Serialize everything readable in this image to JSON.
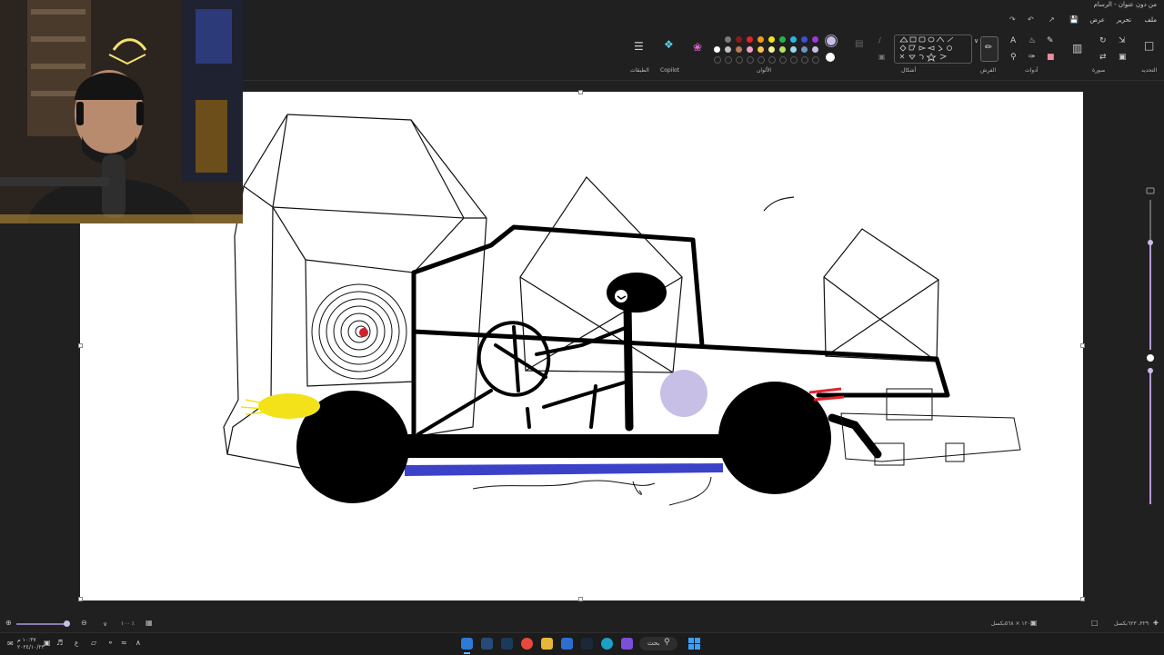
{
  "window": {
    "title": "من دون عنوان - الرسام"
  },
  "menu": {
    "file": "ملف",
    "edit": "تحرير",
    "view": "عرض"
  },
  "ribbon": {
    "groups": {
      "selection": "التحديد",
      "image": "صورة",
      "tools": "أدوات",
      "brushes": "الفرش",
      "shapes": "أشكال",
      "colors": "الألوان",
      "copilot": "Copilot",
      "layers": "الطبقات"
    }
  },
  "palette": {
    "row1": [
      "#1f1f1f",
      "#7a7a7a",
      "#8b1a1a",
      "#e0242b",
      "#f29b1f",
      "#f2e21b",
      "#27b34b",
      "#27b6e6",
      "#3b4fd8",
      "#9a3bd8"
    ],
    "row2": [
      "#ffffff",
      "#c0c0c0",
      "#b97a57",
      "#f2a0c0",
      "#f7c74b",
      "#f7ef9a",
      "#b5e35b",
      "#9ad9ea",
      "#7092be",
      "#c8bfe7"
    ],
    "primary": "#c8bfe7",
    "secondary": "#ffffff"
  },
  "status": {
    "canvas_size": "١٢٠٥ × ٥٦٨بكسل",
    "cursor_pos": "٣٢٩، ٦٢٣بكسل",
    "zoom": "١٠٠ ٪"
  },
  "taskbar": {
    "search": "بحث",
    "time": "١٠:٣٧ م",
    "date": "٢٠٢٤/١٠/٢٣",
    "lang": "ع"
  },
  "icons": {
    "undo": "undo-icon",
    "redo": "redo-icon",
    "save": "save-icon",
    "share": "share-icon",
    "settings": "settings-icon",
    "start": "windows-start-icon"
  }
}
